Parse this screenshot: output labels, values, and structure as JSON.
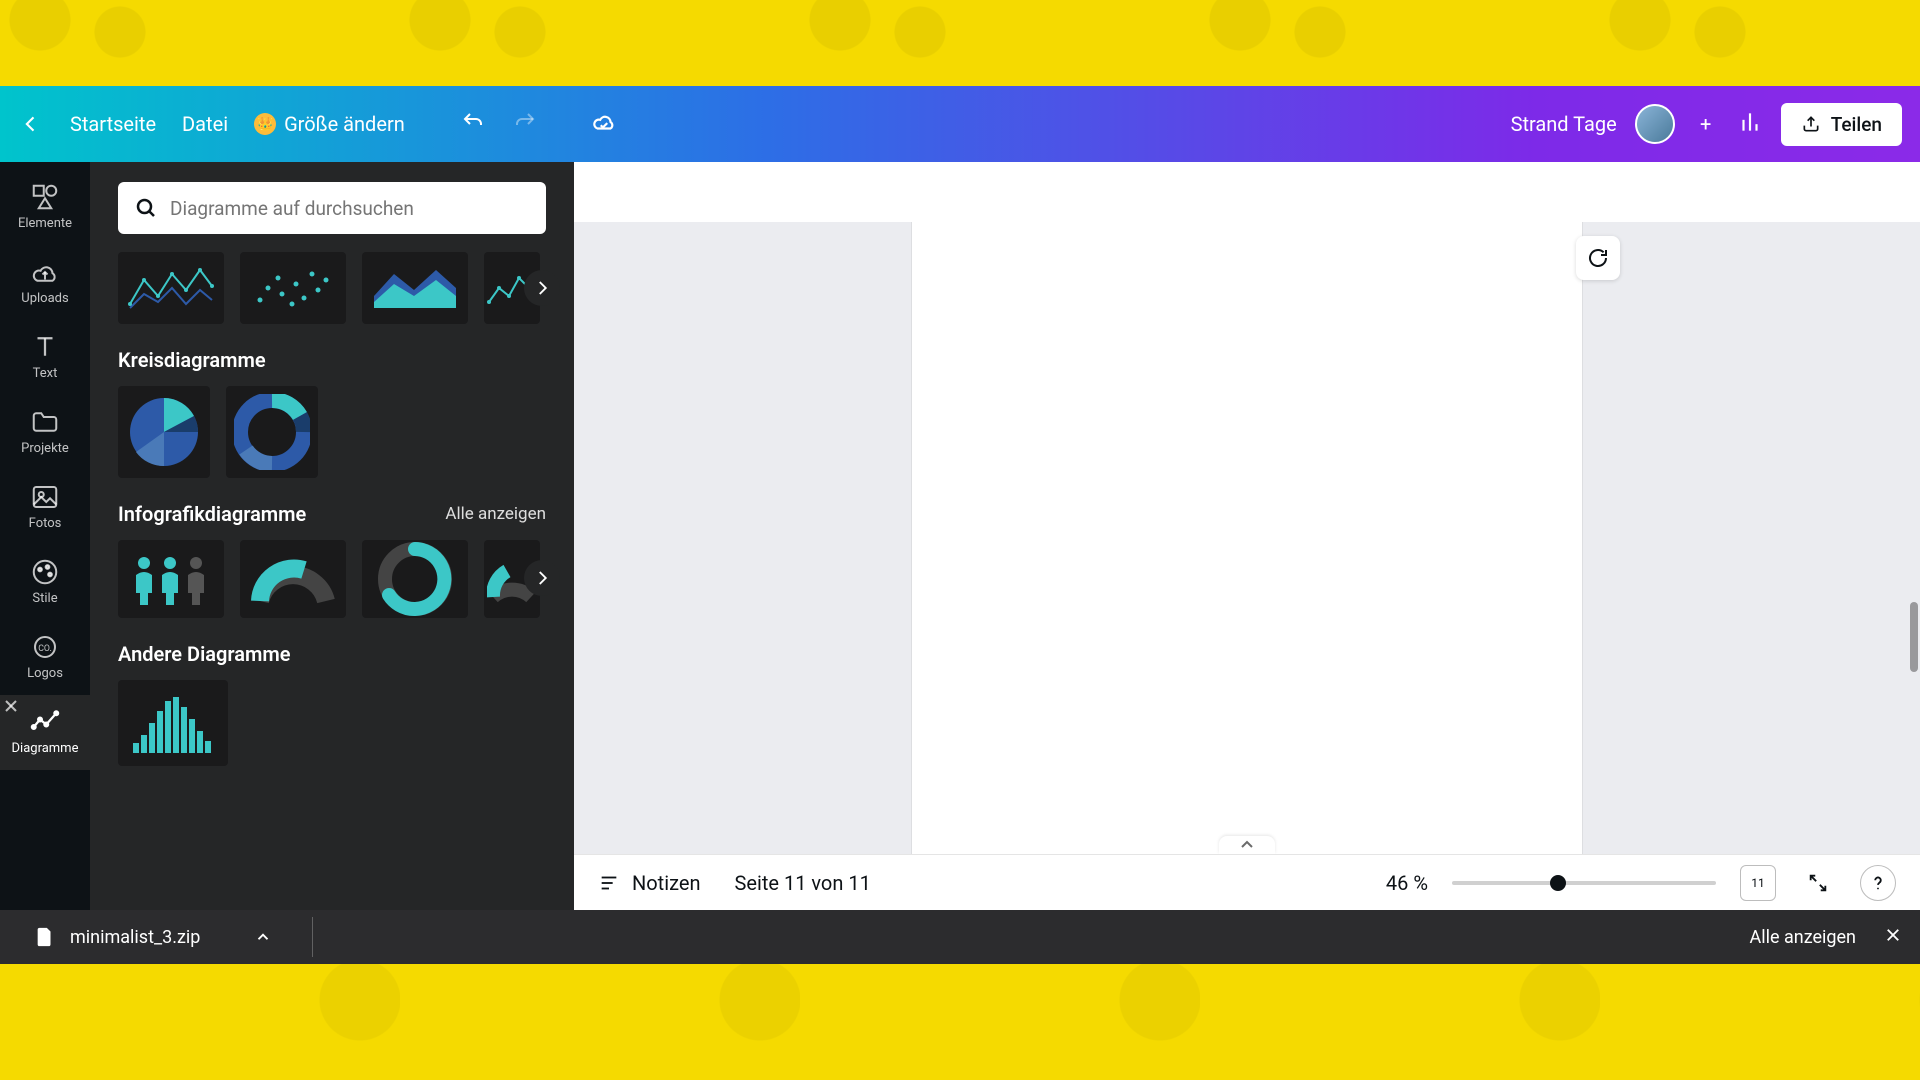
{
  "top": {
    "home": "Startseite",
    "file": "Datei",
    "resize": "Größe ändern",
    "title": "Strand Tage",
    "share": "Teilen"
  },
  "rail": {
    "elements": "Elemente",
    "uploads": "Uploads",
    "text": "Text",
    "projects": "Projekte",
    "photos": "Fotos",
    "styles": "Stile",
    "logos": "Logos",
    "charts": "Diagramme"
  },
  "panel": {
    "search_placeholder": "Diagramme auf durchsuchen",
    "pie_title": "Kreisdiagramme",
    "info_title": "Infografikdiagramme",
    "info_all": "Alle anzeigen",
    "other_title": "Andere Diagramme"
  },
  "bottom": {
    "notes": "Notizen",
    "page_counter": "Seite 11 von 11",
    "zoom": "46 %",
    "grid_num": "11"
  },
  "download": {
    "filename": "minimalist_3.zip",
    "show_all": "Alle anzeigen"
  }
}
